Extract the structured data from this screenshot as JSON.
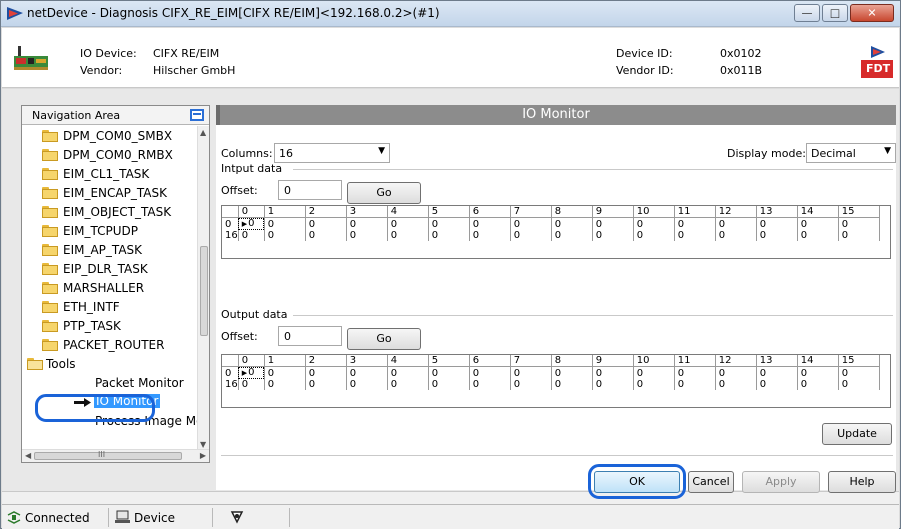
{
  "window": {
    "title": "netDevice - Diagnosis CIFX_RE_EIM[CIFX RE/EIM]<192.168.0.2>(#1)",
    "controls": [
      "minimize-icon",
      "maximize-icon",
      "close-icon"
    ]
  },
  "header": {
    "io_device_label": "IO Device:",
    "io_device_value": "CIFX RE/EIM",
    "vendor_label": "Vendor:",
    "vendor_value": "Hilscher GmbH",
    "device_id_label": "Device ID:",
    "device_id_value": "0x0102",
    "vendor_id_label": "Vendor ID:",
    "vendor_id_value": "0x011B",
    "logo_text": "FDT"
  },
  "navigation": {
    "title": "Navigation Area",
    "items": [
      {
        "label": "DPM_COM0_SMBX",
        "type": "folder"
      },
      {
        "label": "DPM_COM0_RMBX",
        "type": "folder"
      },
      {
        "label": "EIM_CL1_TASK",
        "type": "folder"
      },
      {
        "label": "EIM_ENCAP_TASK",
        "type": "folder"
      },
      {
        "label": "EIM_OBJECT_TASK",
        "type": "folder"
      },
      {
        "label": "EIM_TCPUDP",
        "type": "folder"
      },
      {
        "label": "EIM_AP_TASK",
        "type": "folder"
      },
      {
        "label": "EIP_DLR_TASK",
        "type": "folder"
      },
      {
        "label": "MARSHALLER",
        "type": "folder"
      },
      {
        "label": "ETH_INTF",
        "type": "folder"
      },
      {
        "label": "PTP_TASK",
        "type": "folder"
      },
      {
        "label": "PACKET_ROUTER",
        "type": "folder"
      },
      {
        "label": "Tools",
        "type": "open-folder"
      },
      {
        "label": "Packet Monitor",
        "type": "leaf"
      },
      {
        "label": "IO Monitor",
        "type": "selected"
      },
      {
        "label": "Process Image Monitor",
        "type": "leaf"
      }
    ],
    "scroll_thumb_glyph": "III"
  },
  "io_monitor": {
    "title": "IO Monitor",
    "columns_label": "Columns:",
    "columns_value": "16",
    "display_mode_label": "Display mode:",
    "display_mode_value": "Decimal",
    "input": {
      "section_label": "Intput data",
      "offset_label": "Offset:",
      "offset_value": "0",
      "go_label": "Go",
      "headers": [
        "0",
        "1",
        "2",
        "3",
        "4",
        "5",
        "6",
        "7",
        "8",
        "9",
        "10",
        "11",
        "12",
        "13",
        "14",
        "15"
      ],
      "rows": [
        {
          "row": "0",
          "values": [
            "0",
            "0",
            "0",
            "0",
            "0",
            "0",
            "0",
            "0",
            "0",
            "0",
            "0",
            "0",
            "0",
            "0",
            "0",
            "0"
          ]
        },
        {
          "row": "16",
          "values": [
            "0",
            "0",
            "0",
            "0",
            "0",
            "0",
            "0",
            "0",
            "0",
            "0",
            "0",
            "0",
            "0",
            "0",
            "0",
            "0"
          ]
        }
      ]
    },
    "output": {
      "section_label": "Output data",
      "offset_label": "Offset:",
      "offset_value": "0",
      "go_label": "Go",
      "headers": [
        "0",
        "1",
        "2",
        "3",
        "4",
        "5",
        "6",
        "7",
        "8",
        "9",
        "10",
        "11",
        "12",
        "13",
        "14",
        "15"
      ],
      "rows": [
        {
          "row": "0",
          "values": [
            "0",
            "0",
            "0",
            "0",
            "0",
            "0",
            "0",
            "0",
            "0",
            "0",
            "0",
            "0",
            "0",
            "0",
            "0",
            "0"
          ]
        },
        {
          "row": "16",
          "values": [
            "0",
            "0",
            "0",
            "0",
            "0",
            "0",
            "0",
            "0",
            "0",
            "0",
            "0",
            "0",
            "0",
            "0",
            "0",
            "0"
          ]
        }
      ]
    },
    "update_label": "Update"
  },
  "buttons": {
    "ok": "OK",
    "cancel": "Cancel",
    "apply": "Apply",
    "help": "Help"
  },
  "status": {
    "connected": "Connected",
    "device": "Device"
  },
  "colors": {
    "selection": "#3399ff",
    "highlight_ring": "#1a63d8",
    "title_bar": "#8c8c8c"
  }
}
